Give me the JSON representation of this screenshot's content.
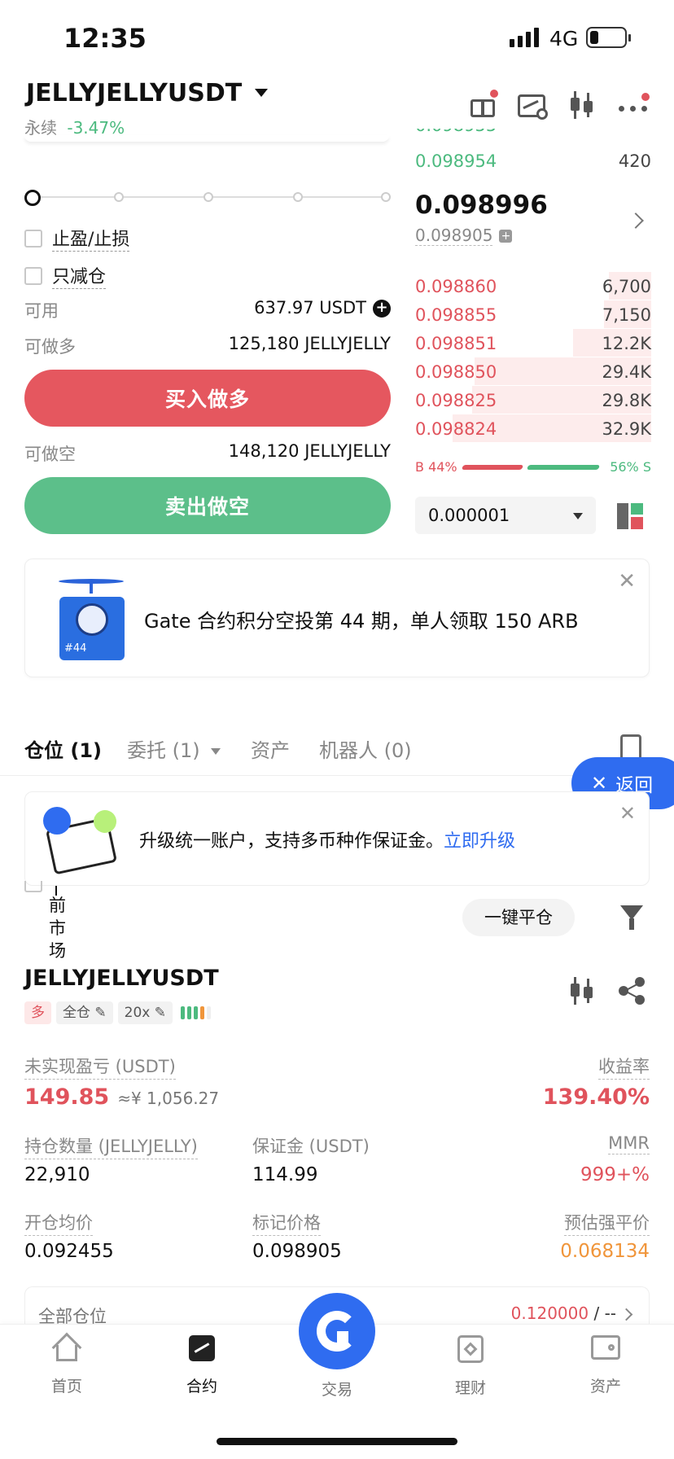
{
  "status_bar": {
    "time": "12:35",
    "network": "4G"
  },
  "header": {
    "symbol": "JELLYJELLYUSDT",
    "contract_type": "永续",
    "change": "-3.47%"
  },
  "order_form": {
    "tp_sl_label": "止盈/止损",
    "reduce_only_label": "只减仓",
    "available_label": "可用",
    "available_value": "637.97 USDT",
    "can_long_label": "可做多",
    "can_long_value": "125,180 JELLYJELLY",
    "buy_button": "买入做多",
    "can_short_label": "可做空",
    "can_short_value": "148,120 JELLYJELLY",
    "sell_button": "卖出做空"
  },
  "orderbook": {
    "top_ask": {
      "price": "0.098954",
      "amount": "420"
    },
    "last_price": "0.098996",
    "mark_price": "0.098905",
    "bids": [
      {
        "price": "0.098860",
        "amount": "6,700",
        "depth": 0.18
      },
      {
        "price": "0.098855",
        "amount": "7,150",
        "depth": 0.2
      },
      {
        "price": "0.098851",
        "amount": "12.2K",
        "depth": 0.33
      },
      {
        "price": "0.098850",
        "amount": "29.4K",
        "depth": 0.75
      },
      {
        "price": "0.098825",
        "amount": "29.8K",
        "depth": 0.76
      },
      {
        "price": "0.098824",
        "amount": "32.9K",
        "depth": 0.84
      }
    ],
    "ratio_buy": "B 44%",
    "ratio_sell": "56% S",
    "buy_ratio": 0.44,
    "precision": "0.000001"
  },
  "banner": {
    "text": "Gate 合约积分空投第 44 期，单人领取 150 ARB",
    "badge": "#44"
  },
  "tabs": [
    {
      "label": "仓位 (1)"
    },
    {
      "label": "委托 (1)"
    },
    {
      "label": "资产"
    },
    {
      "label": "机器人 (0)"
    }
  ],
  "return_button": "返回",
  "upgrade": {
    "text": "升级统一账户，支持多币种作保证金。",
    "link": "立即升级"
  },
  "current_market_label": "前市场",
  "close_all_button": "一键平仓",
  "position": {
    "symbol": "JELLYJELLYUSDT",
    "side": "多",
    "margin_mode": "全仓",
    "leverage": "20x",
    "unrealized_label": "未实现盈亏 (USDT)",
    "unrealized_value": "149.85",
    "unrealized_cny": "≈¥ 1,056.27",
    "roe_label": "收益率",
    "roe_value": "139.40%",
    "size_label": "持仓数量 (JELLYJELLY)",
    "size_value": "22,910",
    "margin_label": "保证金 (USDT)",
    "margin_value": "114.99",
    "mmr_label": "MMR",
    "mmr_value": "999+%",
    "entry_label": "开仓均价",
    "entry_value": "0.092455",
    "mark_label": "标记价格",
    "mark_value": "0.098905",
    "liq_label": "预估强平价",
    "liq_value": "0.068134",
    "all_positions_label": "全部仓位",
    "all_positions_value": "0.120000",
    "all_positions_suffix": "/ --"
  },
  "bottom_nav": [
    {
      "label": "首页",
      "icon": "home-icon"
    },
    {
      "label": "合约",
      "icon": "futures-icon"
    },
    {
      "label": "交易",
      "icon": "gate-logo-icon"
    },
    {
      "label": "理财",
      "icon": "finance-icon"
    },
    {
      "label": "资产",
      "icon": "wallet-icon"
    }
  ],
  "colors": {
    "red": "#e0535c",
    "green": "#4cba7f",
    "blue": "#2f6cf0",
    "orange": "#f0953a"
  }
}
